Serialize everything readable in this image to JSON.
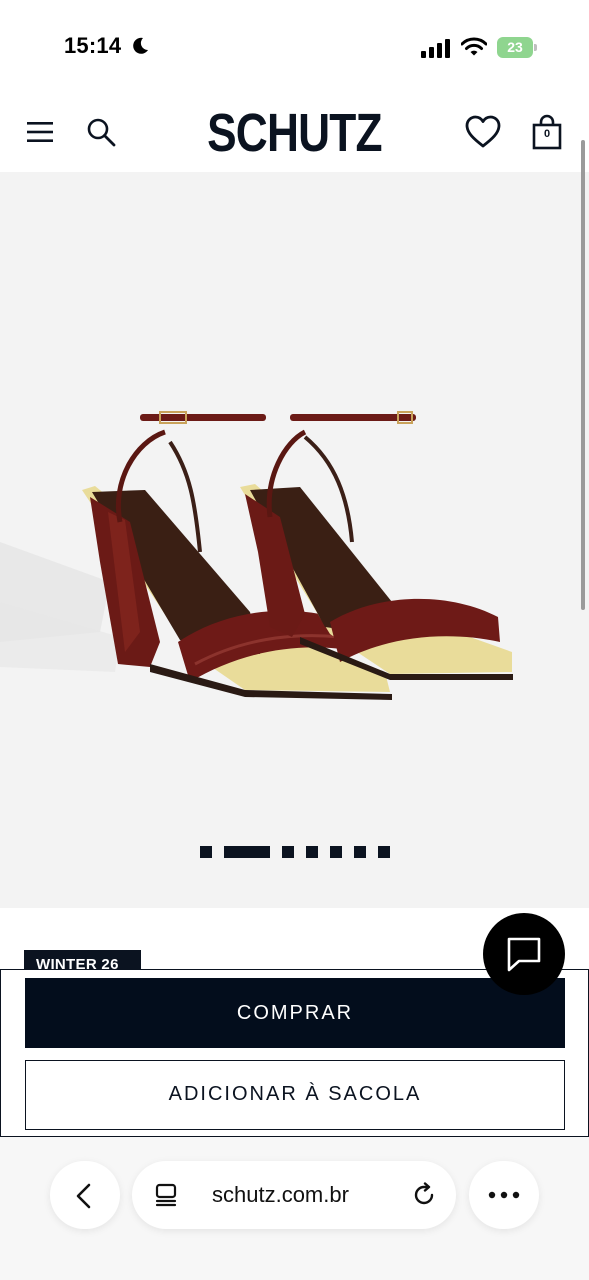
{
  "status_bar": {
    "time": "15:14",
    "battery_level": "23",
    "icons": [
      "moon-icon",
      "signal-icon",
      "wifi-icon",
      "battery-icon"
    ]
  },
  "header": {
    "logo": "SCHUTZ",
    "bag_count": "0",
    "icons": [
      "hamburger-menu-icon",
      "search-icon",
      "heart-icon",
      "bag-icon"
    ]
  },
  "product": {
    "image_alt": "wedge sandals",
    "carousel": {
      "total": 7,
      "active_index": 1
    },
    "badge": "WINTER 26"
  },
  "actions": {
    "buy_label": "COMPRAR",
    "add_to_bag_label": "ADICIONAR À SACOLA"
  },
  "browser": {
    "url": "schutz.com.br",
    "icons": [
      "back-icon",
      "tabs-icon",
      "reload-icon",
      "more-icon"
    ]
  },
  "colors": {
    "brand_dark": "#030d1c",
    "image_background": "#f3f3f3",
    "sandal_burgundy": "#6b1a16",
    "sandal_trim": "#e9dc9a"
  }
}
